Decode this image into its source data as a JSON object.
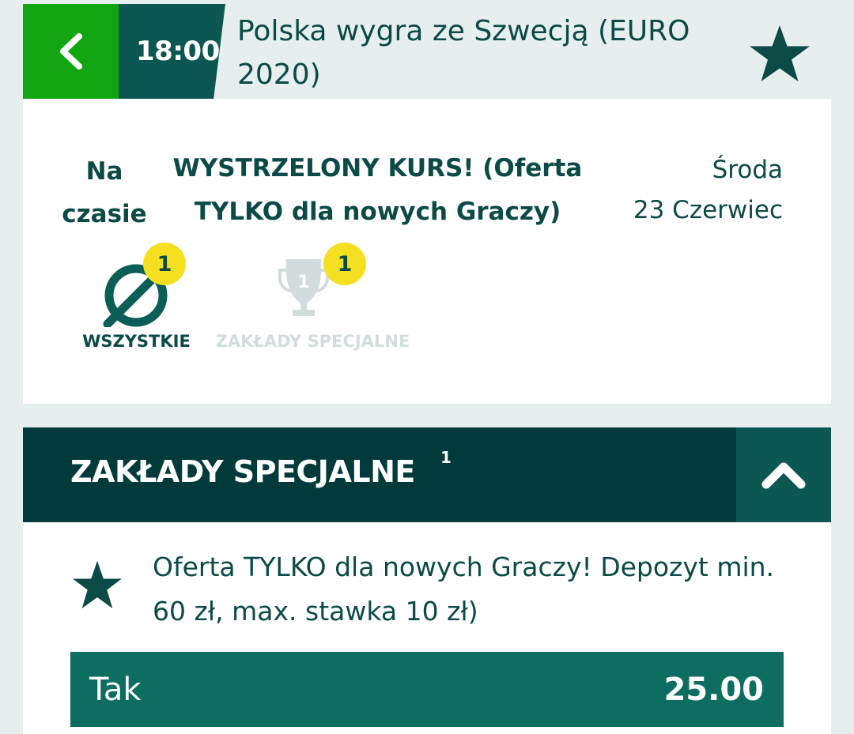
{
  "header": {
    "time": "18:00",
    "title": "Polska wygra ze Szwecją (EURO 2020)"
  },
  "event": {
    "status_line1": "Na",
    "status_line2": "czasie",
    "promo_line1": "WYSTRZELONY KURS! (Oferta",
    "promo_line2": "TYLKO dla nowych Graczy)",
    "day": "Środa",
    "date": "23 Czerwiec"
  },
  "filters": [
    {
      "label": "WSZYSTKIE",
      "count": "1",
      "icon": "all-markets-icon"
    },
    {
      "label": "ZAKŁADY SPECJALNE",
      "count": "1",
      "icon": "trophy-icon"
    }
  ],
  "trophy_number": "1",
  "section": {
    "title": "ZAKŁADY SPECJALNE",
    "count": "1"
  },
  "market": {
    "description": "Oferta TYLKO dla nowych Graczy! Depozyt min. 60 zł, max. stawka 10 zł)",
    "outcome_label": "Tak",
    "odds": "25.00"
  },
  "colors": {
    "green": "#12a512",
    "dark_teal": "#0d5752",
    "darkest_teal": "#003a3a",
    "odds_button": "#0d6d61",
    "badge_yellow": "#f4e021",
    "text": "#0b4a45",
    "inactive": "#d3dcdc"
  }
}
